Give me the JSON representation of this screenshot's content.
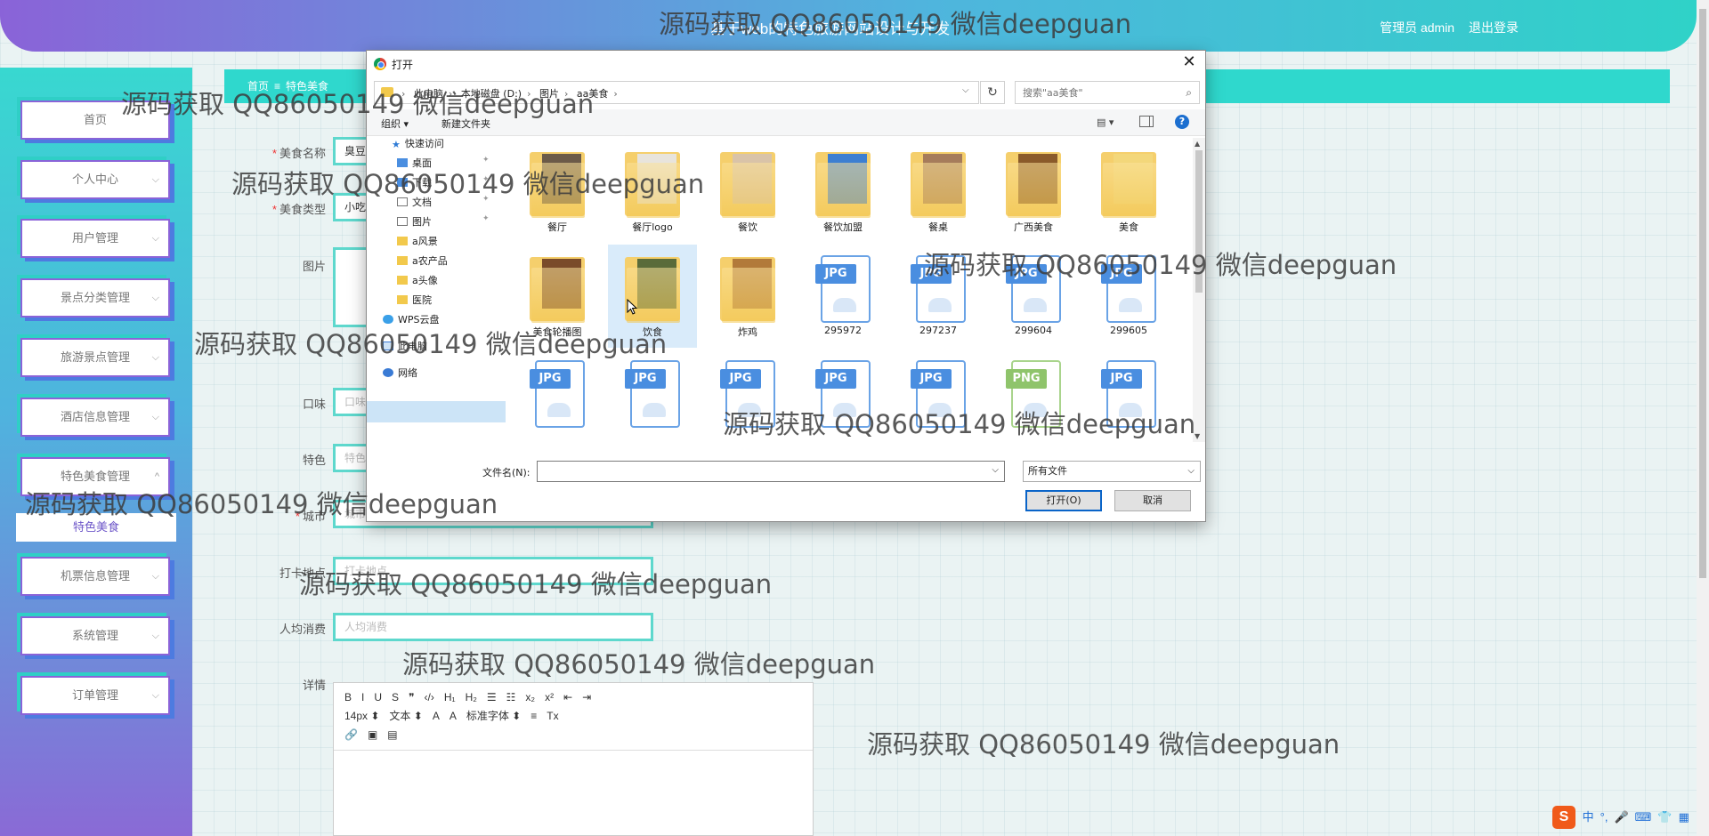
{
  "header": {
    "title": "基于web的特色旅游网站设计与开发",
    "user_label": "管理员 admin",
    "logout_label": "退出登录"
  },
  "sidebar": {
    "items": [
      {
        "label": "首页"
      },
      {
        "label": "个人中心",
        "arrow": "⌵"
      },
      {
        "label": "用户管理",
        "arrow": "⌵"
      },
      {
        "label": "景点分类管理",
        "arrow": "⌵"
      },
      {
        "label": "旅游景点管理",
        "arrow": "⌵"
      },
      {
        "label": "酒店信息管理",
        "arrow": "⌵"
      },
      {
        "label": "特色美食管理",
        "arrow": "^"
      },
      {
        "label": "机票信息管理",
        "arrow": "⌵"
      },
      {
        "label": "系统管理",
        "arrow": "⌵"
      },
      {
        "label": "订单管理",
        "arrow": "⌵"
      }
    ],
    "active_submenu": "特色美食"
  },
  "breadcrumb": {
    "home": "首页",
    "sep": "≡",
    "current": "特色美食"
  },
  "form": {
    "name_label": "美食名称",
    "name_value": "臭豆",
    "type_label": "美食类型",
    "type_value": "小吃",
    "image_label": "图片",
    "taste_label": "口味",
    "taste_placeholder": "口味",
    "feature_label": "特色",
    "feature_placeholder": "特色",
    "city_label": "城市",
    "city_placeholder": "城市",
    "checkin_label": "打卡地点",
    "checkin_placeholder": "打卡地点",
    "avg_label": "人均消费",
    "avg_placeholder": "人均消费",
    "detail_label": "详情",
    "editor_row1": [
      "B",
      "I",
      "U",
      "S",
      "❞",
      "‹/›",
      "H₁",
      "H₂",
      "☰",
      "☷",
      "x₂",
      "x²",
      "⇤",
      "⇥"
    ],
    "editor_row2": [
      "14px ⬍",
      "文本 ⬍",
      "A",
      "A",
      "标准字体 ⬍",
      "≡",
      "Tx"
    ],
    "editor_row3": [
      "🔗",
      "▣",
      "▤"
    ]
  },
  "dialog": {
    "title": "打开",
    "close": "✕",
    "path": [
      "此电脑",
      "本地磁盘 (D:)",
      "图片",
      "aa美食"
    ],
    "search_placeholder": "搜索\"aa美食\"",
    "toolbar": {
      "organize": "组织 ▾",
      "new_folder": "新建文件夹",
      "help": "?"
    },
    "nav": [
      {
        "label": "快速访问",
        "icon": "star-icon"
      },
      {
        "label": "桌面",
        "icon": "desktop-icon",
        "pinned": true
      },
      {
        "label": "下载",
        "icon": "download-icon",
        "pinned": true
      },
      {
        "label": "文档",
        "icon": "document-icon",
        "pinned": true
      },
      {
        "label": "图片",
        "icon": "pictures-icon",
        "pinned": true
      },
      {
        "label": "a风景",
        "icon": "folder-icon"
      },
      {
        "label": "a农产品",
        "icon": "folder-icon"
      },
      {
        "label": "a头像",
        "icon": "folder-icon"
      },
      {
        "label": "医院",
        "icon": "folder-icon"
      },
      {
        "label": "WPS云盘",
        "icon": "cloud-icon"
      },
      {
        "label": "此电脑",
        "icon": "computer-icon"
      },
      {
        "label": "网络",
        "icon": "network-icon"
      }
    ],
    "files": [
      {
        "name": "餐厅",
        "kind": "folder",
        "photo": "#6b5a48"
      },
      {
        "name": "餐厅logo",
        "kind": "folder",
        "photo": "#e8e4dc"
      },
      {
        "name": "餐饮",
        "kind": "folder",
        "photo": "#d9c3a8"
      },
      {
        "name": "餐饮加盟",
        "kind": "folder",
        "photo": "#3d7fd1"
      },
      {
        "name": "餐桌",
        "kind": "folder",
        "photo": "#a67c5b"
      },
      {
        "name": "广西美食",
        "kind": "folder",
        "photo": "#8a5a2a"
      },
      {
        "name": "美食",
        "kind": "folder",
        "photo": "#f3d77a"
      },
      {
        "name": "美食轮播图",
        "kind": "folder",
        "photo": "#7a4b2a"
      },
      {
        "name": "饮食",
        "kind": "folder",
        "photo": "#5a6b3a"
      },
      {
        "name": "炸鸡",
        "kind": "folder",
        "photo": "#b27a3a"
      },
      {
        "name": "295972",
        "kind": "jpg"
      },
      {
        "name": "297237",
        "kind": "jpg"
      },
      {
        "name": "299604",
        "kind": "jpg"
      },
      {
        "name": "299605",
        "kind": "jpg"
      },
      {
        "name": "",
        "kind": "jpg"
      },
      {
        "name": "",
        "kind": "jpg"
      },
      {
        "name": "",
        "kind": "jpg"
      },
      {
        "name": "",
        "kind": "jpg"
      },
      {
        "name": "",
        "kind": "jpg"
      },
      {
        "name": "",
        "kind": "png"
      },
      {
        "name": "",
        "kind": "jpg"
      }
    ],
    "filename_label": "文件名(N):",
    "filename_value": "",
    "filetype_value": "所有文件",
    "open_button": "打开(O)",
    "cancel_button": "取消"
  },
  "ime": {
    "logo": "S",
    "items": [
      "中",
      "°,",
      "🎤",
      "⌨",
      "👕",
      "▦"
    ]
  },
  "watermark": "源码获取 QQ86050149 微信deepguan"
}
